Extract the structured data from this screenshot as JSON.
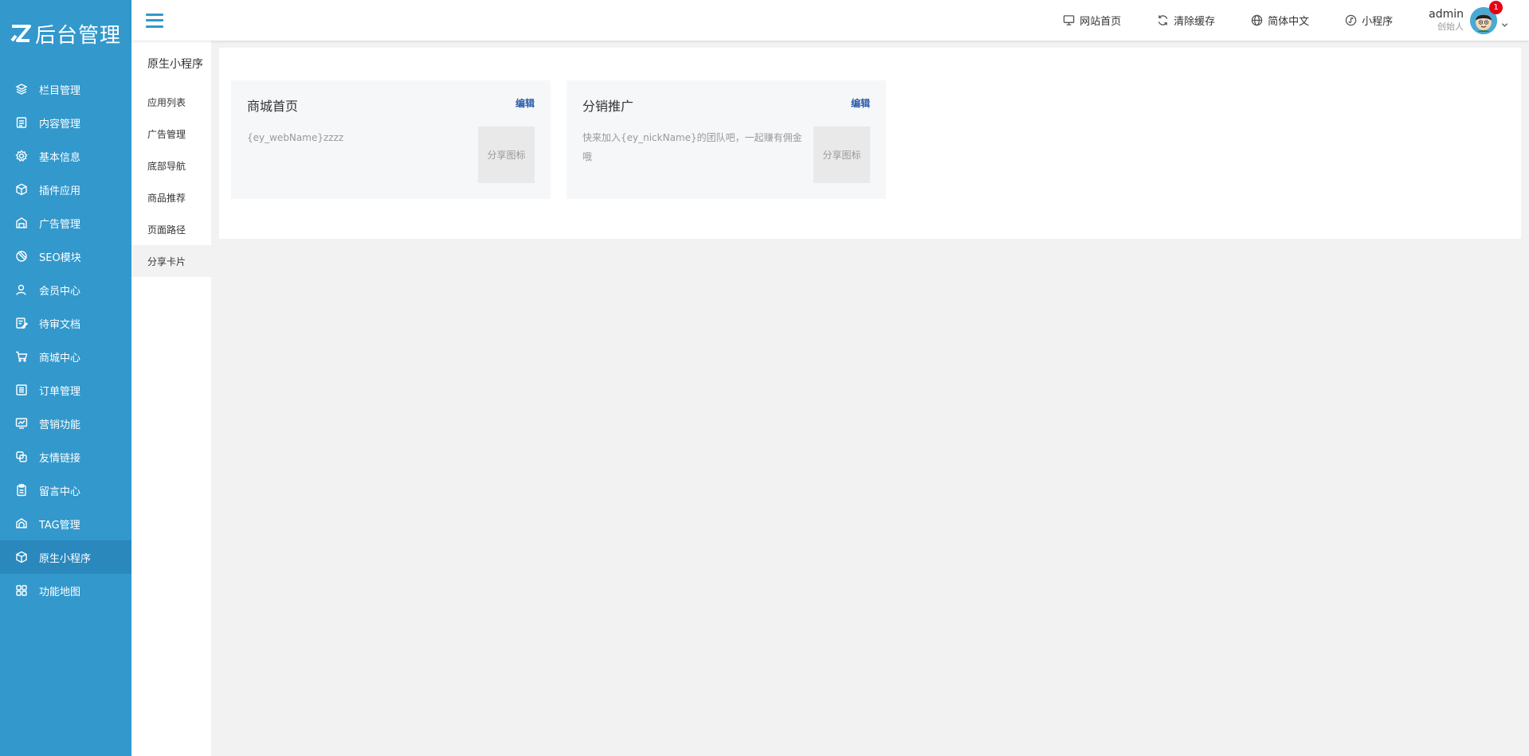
{
  "brand": {
    "logo_text": "后台管理"
  },
  "sidebar": {
    "items": [
      {
        "label": "栏目管理",
        "icon": "layers-icon"
      },
      {
        "label": "内容管理",
        "icon": "document-icon"
      },
      {
        "label": "基本信息",
        "icon": "gear-icon"
      },
      {
        "label": "插件应用",
        "icon": "cube-icon"
      },
      {
        "label": "广告管理",
        "icon": "ad-icon"
      },
      {
        "label": "SEO模块",
        "icon": "seo-icon"
      },
      {
        "label": "会员中心",
        "icon": "user-icon"
      },
      {
        "label": "待审文档",
        "icon": "edit-doc-icon"
      },
      {
        "label": "商城中心",
        "icon": "cart-icon"
      },
      {
        "label": "订单管理",
        "icon": "list-icon"
      },
      {
        "label": "营销功能",
        "icon": "chart-icon"
      },
      {
        "label": "友情链接",
        "icon": "link-icon"
      },
      {
        "label": "留言中心",
        "icon": "clipboard-icon"
      },
      {
        "label": "TAG管理",
        "icon": "tag-icon"
      },
      {
        "label": "原生小程序",
        "icon": "cube-icon"
      },
      {
        "label": "功能地图",
        "icon": "grid-icon"
      }
    ],
    "active_index": 14
  },
  "topbar": {
    "links": [
      {
        "label": "网站首页",
        "icon": "monitor-icon"
      },
      {
        "label": "清除缓存",
        "icon": "refresh-icon"
      },
      {
        "label": "简体中文",
        "icon": "globe-icon"
      },
      {
        "label": "小程序",
        "icon": "miniprogram-icon"
      }
    ],
    "user": {
      "name": "admin",
      "role": "创始人",
      "badge": "1"
    }
  },
  "subnav": {
    "title": "原生小程序",
    "items": [
      {
        "label": "应用列表"
      },
      {
        "label": "广告管理"
      },
      {
        "label": "底部导航"
      },
      {
        "label": "商品推荐"
      },
      {
        "label": "页面路径"
      },
      {
        "label": "分享卡片"
      }
    ],
    "active_index": 5
  },
  "cards": [
    {
      "title": "商城首页",
      "edit": "编辑",
      "desc": "{ey_webName}zzzz",
      "image_label": "分享图标"
    },
    {
      "title": "分销推广",
      "edit": "编辑",
      "desc": "快来加入{ey_nickName}的团队吧，一起赚有佣金哦",
      "image_label": "分享图标"
    }
  ],
  "colors": {
    "sidebar_bg": "#3398cc",
    "sidebar_active": "#2a88bd",
    "edit_link": "#2a5caa",
    "badge": "#e60012"
  }
}
